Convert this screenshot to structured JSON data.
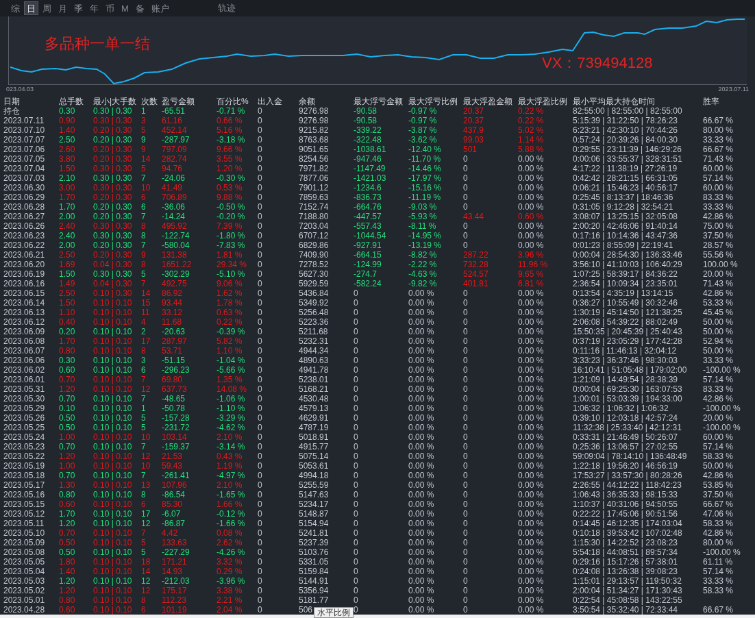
{
  "tabs": [
    {
      "label": "综",
      "selected": false
    },
    {
      "label": "日",
      "selected": true
    },
    {
      "label": "周",
      "selected": false
    },
    {
      "label": "月",
      "selected": false
    },
    {
      "label": "季",
      "selected": false
    },
    {
      "label": "年",
      "selected": false
    },
    {
      "label": "币",
      "selected": false
    },
    {
      "label": "M",
      "selected": false
    },
    {
      "label": "备",
      "selected": false
    },
    {
      "label": "账户",
      "selected": false
    }
  ],
  "track_label": "轨迹",
  "chart": {
    "annotations": [
      "多品种一单一结",
      "VX：739494128"
    ],
    "start_date": "023.04.03",
    "end_date": "2023.07.11"
  },
  "table": {
    "columns": [
      "日期",
      "总手数",
      "最小|大手数",
      "次数",
      "盈亏金额",
      "百分比%",
      "出入金",
      "余额",
      "最大浮亏金额",
      "最大浮亏比例",
      "最大浮盈金额",
      "最大浮盈比例",
      "最小平均最大持仓时间",
      "胜率"
    ],
    "rows": [
      {
        "cells": [
          "持仓",
          "0.30",
          "0.30 | 0.30",
          "1",
          "-65.51",
          "-0.71 %",
          "0",
          "9276.98",
          "-90.58",
          "-0.97 %",
          "20.37",
          "0.22 %",
          "82:55:00 | 82:55:00 | 82:55:00"
        ],
        "profit": false,
        "float_loss_marked": true,
        "float_profit_marked": true
      },
      {
        "cells": [
          "2023.07.11",
          "0.90",
          "0.30 | 0.30",
          "3",
          "61.16",
          "0.66 %",
          "0",
          "9276.98",
          "-90.58",
          "-0.97 %",
          "20.37",
          "0.22 %",
          "5:15:39 | 31:22:50 | 78:26:23",
          "66.67 %"
        ],
        "profit": true,
        "float_loss_marked": true,
        "float_profit_marked": true
      },
      {
        "cells": [
          "2023.07.10",
          "1.40",
          "0.20 | 0.30",
          "5",
          "452.14",
          "5.16 %",
          "0",
          "9215.82",
          "-339.22",
          "-3.87 %",
          "437.9",
          "5.02 %",
          "6:23:21 | 42:30:10 | 70:44:26",
          "80.00 %"
        ],
        "profit": true,
        "float_loss_marked": true,
        "float_profit_marked": true
      },
      {
        "cells": [
          "2023.07.07",
          "2.50",
          "0.20 | 0.30",
          "9",
          "-287.97",
          "-3.18 %",
          "0",
          "8763.68",
          "-322.48",
          "-3.62 %",
          "99.03",
          "1.14 %",
          "0:57:24 | 20:39:26 | 84:00:30",
          "33.33 %"
        ],
        "profit": false,
        "float_loss_marked": true,
        "float_profit_marked": true
      },
      {
        "cells": [
          "2023.07.06",
          "2.60",
          "0.20 | 0.30",
          "9",
          "797.09",
          "9.66 %",
          "0",
          "9051.65",
          "-1038.61",
          "-12.40 %",
          "501",
          "5.88 %",
          "0:29:55 | 23:11:39 | 146:29:26",
          "66.67 %"
        ],
        "profit": true,
        "float_loss_marked": true,
        "float_profit_marked": true
      },
      {
        "cells": [
          "2023.07.05",
          "3.80",
          "0.20 | 0.30",
          "14",
          "282.74",
          "3.55 %",
          "0",
          "8254.56",
          "-947.46",
          "-11.70 %",
          "0",
          "0.00 %",
          "0:00:06 | 33:55:37 | 328:31:51",
          "71.43 %"
        ],
        "profit": true,
        "float_loss_marked": true,
        "float_profit_marked": false
      },
      {
        "cells": [
          "2023.07.04",
          "1.50",
          "0.30 | 0.30",
          "5",
          "94.76",
          "1.20 %",
          "0",
          "7971.82",
          "-1147.49",
          "-14.46 %",
          "0",
          "0.00 %",
          "4:17:22 | 11:38:19 | 27:26:19",
          "60.00 %"
        ],
        "profit": true,
        "float_loss_marked": true,
        "float_profit_marked": false
      },
      {
        "cells": [
          "2023.07.03",
          "2.10",
          "0.30 | 0.30",
          "7",
          "-24.06",
          "-0.30 %",
          "0",
          "7877.06",
          "-1421.03",
          "-17.97 %",
          "0",
          "0.00 %",
          "0:42:42 | 28:21:15 | 66:31:05",
          "57.14 %"
        ],
        "profit": false,
        "float_loss_marked": true,
        "float_profit_marked": false
      },
      {
        "cells": [
          "2023.06.30",
          "3.00",
          "0.30 | 0.30",
          "10",
          "41.49",
          "0.53 %",
          "0",
          "7901.12",
          "-1234.6",
          "-15.16 %",
          "0",
          "0.00 %",
          "0:06:21 | 15:46:23 | 40:56:17",
          "60.00 %"
        ],
        "profit": true,
        "float_loss_marked": true,
        "float_profit_marked": false
      },
      {
        "cells": [
          "2023.06.29",
          "1.70",
          "0.20 | 0.30",
          "6",
          "706.89",
          "9.88 %",
          "0",
          "7859.63",
          "-836.73",
          "-11.19 %",
          "0",
          "0.00 %",
          "0:25:45 | 8:13:37 | 18:46:36",
          "83.33 %"
        ],
        "profit": true,
        "float_loss_marked": true,
        "float_profit_marked": false
      },
      {
        "cells": [
          "2023.06.28",
          "1.70",
          "0.20 | 0.30",
          "6",
          "-36.06",
          "-0.50 %",
          "0",
          "7152.74",
          "-664.76",
          "-9.03 %",
          "0",
          "0.00 %",
          "0:31:05 | 9:12:28 | 32:54:21",
          "33.33 %"
        ],
        "profit": false,
        "float_loss_marked": true,
        "float_profit_marked": false
      },
      {
        "cells": [
          "2023.06.27",
          "2.00",
          "0.20 | 0.30",
          "7",
          "-14.24",
          "-0.20 %",
          "0",
          "7188.80",
          "-447.57",
          "-5.93 %",
          "43.44",
          "0.60 %",
          "3:08:07 | 13:25:15 | 32:05:08",
          "42.86 %"
        ],
        "profit": false,
        "float_loss_marked": true,
        "float_profit_marked": true
      },
      {
        "cells": [
          "2023.06.26",
          "2.40",
          "0.30 | 0.30",
          "8",
          "495.92",
          "7.39 %",
          "0",
          "7203.04",
          "-557.43",
          "-8.11 %",
          "0",
          "0.00 %",
          "2:00:20 | 42:46:06 | 91:40:14",
          "75.00 %"
        ],
        "profit": true,
        "float_loss_marked": true,
        "float_profit_marked": false
      },
      {
        "cells": [
          "2023.06.23",
          "2.40",
          "0.30 | 0.30",
          "8",
          "-122.74",
          "-1.80 %",
          "0",
          "6707.12",
          "-1044.54",
          "-14.95 %",
          "0",
          "0.00 %",
          "0:17:16 | 10:14:36 | 43:47:36",
          "37.50 %"
        ],
        "profit": false,
        "float_loss_marked": true,
        "float_profit_marked": false
      },
      {
        "cells": [
          "2023.06.22",
          "2.00",
          "0.20 | 0.30",
          "7",
          "-580.04",
          "-7.83 %",
          "0",
          "6829.86",
          "-927.91",
          "-13.19 %",
          "0",
          "0.00 %",
          "0:01:23 | 8:55:09 | 22:19:41",
          "28.57 %"
        ],
        "profit": false,
        "float_loss_marked": true,
        "float_profit_marked": false
      },
      {
        "cells": [
          "2023.06.21",
          "2.50",
          "0.20 | 0.30",
          "9",
          "131.38",
          "1.81 %",
          "0",
          "7409.90",
          "-664.15",
          "-8.82 %",
          "287.22",
          "3.96 %",
          "0:00:04 | 28:54:30 | 136:33:46",
          "55.56 %"
        ],
        "profit": true,
        "float_loss_marked": true,
        "float_profit_marked": true
      },
      {
        "cells": [
          "2023.06.20",
          "1.69",
          "0.04 | 0.30",
          "8",
          "1651.22",
          "29.34 %",
          "0",
          "7278.52",
          "-124.99",
          "-2.22 %",
          "732.28",
          "11.96 %",
          "3:56:10 | 41:10:03 | 106:40:29",
          "100.00 %"
        ],
        "profit": true,
        "float_loss_marked": true,
        "float_profit_marked": true
      },
      {
        "cells": [
          "2023.06.19",
          "1.50",
          "0.30 | 0.30",
          "5",
          "-302.29",
          "-5.10 %",
          "0",
          "5627.30",
          "-274.7",
          "-4.63 %",
          "524.57",
          "9.65 %",
          "1:07:25 | 58:39:17 | 84:36:22",
          "20.00 %"
        ],
        "profit": false,
        "float_loss_marked": true,
        "float_profit_marked": true
      },
      {
        "cells": [
          "2023.06.16",
          "1.49",
          "0.04 | 0.30",
          "7",
          "492.75",
          "9.06 %",
          "0",
          "5929.59",
          "-582.24",
          "-9.82 %",
          "401.81",
          "6.81 %",
          "2:36:54 | 10:09:34 | 23:35:01",
          "71.43 %"
        ],
        "profit": true,
        "float_loss_marked": true,
        "float_profit_marked": true
      },
      {
        "cells": [
          "2023.06.15",
          "2.50",
          "0.10 | 0.30",
          "14",
          "86.92",
          "1.62 %",
          "0",
          "5436.84",
          "0",
          "0.00 %",
          "0",
          "0.00 %",
          "0:13:54 | 4:35:19 | 13:14:15",
          "42.86 %"
        ],
        "profit": true,
        "float_loss_marked": false,
        "float_profit_marked": false
      },
      {
        "cells": [
          "2023.06.14",
          "1.50",
          "0.10 | 0.10",
          "15",
          "93.44",
          "1.78 %",
          "0",
          "5349.92",
          "0",
          "0.00 %",
          "0",
          "0.00 %",
          "0:36:27 | 10:55:49 | 30:32:46",
          "53.33 %"
        ],
        "profit": true,
        "float_loss_marked": false,
        "float_profit_marked": false
      },
      {
        "cells": [
          "2023.06.13",
          "1.10",
          "0.10 | 0.10",
          "11",
          "33.12",
          "0.63 %",
          "0",
          "5256.48",
          "0",
          "0.00 %",
          "0",
          "0.00 %",
          "1:30:19 | 45:14:50 | 121:38:25",
          "45.45 %"
        ],
        "profit": true,
        "float_loss_marked": false,
        "float_profit_marked": false
      },
      {
        "cells": [
          "2023.06.12",
          "0.40",
          "0.10 | 0.10",
          "4",
          "11.68",
          "0.22 %",
          "0",
          "5223.36",
          "0",
          "0.00 %",
          "0",
          "0.00 %",
          "2:06:08 | 54:39:22 | 88:02:49",
          "50.00 %"
        ],
        "profit": true,
        "float_loss_marked": false,
        "float_profit_marked": false
      },
      {
        "cells": [
          "2023.06.09",
          "0.20",
          "0.10 | 0.10",
          "2",
          "-20.63",
          "-0.39 %",
          "0",
          "5211.68",
          "0",
          "0.00 %",
          "0",
          "0.00 %",
          "15:50:35 | 20:45:39 | 25:40:43",
          "50.00 %"
        ],
        "profit": false,
        "float_loss_marked": false,
        "float_profit_marked": false
      },
      {
        "cells": [
          "2023.06.08",
          "1.70",
          "0.10 | 0.10",
          "17",
          "287.97",
          "5.82 %",
          "0",
          "5232.31",
          "0",
          "0.00 %",
          "0",
          "0.00 %",
          "0:37:19 | 23:05:29 | 177:42:28",
          "52.94 %"
        ],
        "profit": true,
        "float_loss_marked": false,
        "float_profit_marked": false
      },
      {
        "cells": [
          "2023.06.07",
          "0.80",
          "0.10 | 0.10",
          "8",
          "53.71",
          "1.10 %",
          "0",
          "4944.34",
          "0",
          "0.00 %",
          "0",
          "0.00 %",
          "0:11:16 | 11:46:13 | 32:04:12",
          "50.00 %"
        ],
        "profit": true,
        "float_loss_marked": false,
        "float_profit_marked": false
      },
      {
        "cells": [
          "2023.06.06",
          "0.30",
          "0.10 | 0.10",
          "3",
          "-51.15",
          "-1.04 %",
          "0",
          "4890.63",
          "0",
          "0.00 %",
          "0",
          "0.00 %",
          "3:33:23 | 36:37:46 | 98:30:03",
          "33.33 %"
        ],
        "profit": false,
        "float_loss_marked": false,
        "float_profit_marked": false
      },
      {
        "cells": [
          "2023.06.02",
          "0.60",
          "0.10 | 0.10",
          "6",
          "-296.23",
          "-5.66 %",
          "0",
          "4941.78",
          "0",
          "0.00 %",
          "0",
          "0.00 %",
          "16:10:41 | 51:05:48 | 179:02:00",
          "-100.00 %"
        ],
        "profit": false,
        "float_loss_marked": false,
        "float_profit_marked": false
      },
      {
        "cells": [
          "2023.06.01",
          "0.70",
          "0.10 | 0.10",
          "7",
          "69.80",
          "1.35 %",
          "0",
          "5238.01",
          "0",
          "0.00 %",
          "0",
          "0.00 %",
          "1:21:09 | 14:49:54 | 28:38:39",
          "57.14 %"
        ],
        "profit": true,
        "float_loss_marked": false,
        "float_profit_marked": false
      },
      {
        "cells": [
          "2023.05.31",
          "1.20",
          "0.10 | 0.10",
          "12",
          "637.73",
          "14.08 %",
          "0",
          "5168.21",
          "0",
          "0.00 %",
          "0",
          "0.00 %",
          "0:00:04 | 69:25:30 | 163:07:53",
          "83.33 %"
        ],
        "profit": true,
        "float_loss_marked": false,
        "float_profit_marked": false
      },
      {
        "cells": [
          "2023.05.30",
          "0.70",
          "0.10 | 0.10",
          "7",
          "-48.65",
          "-1.06 %",
          "0",
          "4530.48",
          "0",
          "0.00 %",
          "0",
          "0.00 %",
          "1:00:01 | 53:03:39 | 194:33:00",
          "42.86 %"
        ],
        "profit": false,
        "float_loss_marked": false,
        "float_profit_marked": false
      },
      {
        "cells": [
          "2023.05.29",
          "0.10",
          "0.10 | 0.10",
          "1",
          "-50.78",
          "-1.10 %",
          "0",
          "4579.13",
          "0",
          "0.00 %",
          "0",
          "0.00 %",
          "1:06:32 | 1:06:32 | 1:06:32",
          "-100.00 %"
        ],
        "profit": false,
        "float_loss_marked": false,
        "float_profit_marked": false
      },
      {
        "cells": [
          "2023.05.26",
          "0.50",
          "0.10 | 0.10",
          "5",
          "-157.28",
          "-3.29 %",
          "0",
          "4629.91",
          "0",
          "0.00 %",
          "0",
          "0.00 %",
          "0:39:10 | 12:03:18 | 42:57:24",
          "20.00 %"
        ],
        "profit": false,
        "float_loss_marked": false,
        "float_profit_marked": false
      },
      {
        "cells": [
          "2023.05.25",
          "0.50",
          "0.10 | 0.10",
          "5",
          "-231.72",
          "-4.62 %",
          "0",
          "4787.19",
          "0",
          "0.00 %",
          "0",
          "0.00 %",
          "11:32:38 | 25:33:40 | 42:12:31",
          "-100.00 %"
        ],
        "profit": false,
        "float_loss_marked": false,
        "float_profit_marked": false
      },
      {
        "cells": [
          "2023.05.24",
          "1.00",
          "0.10 | 0.10",
          "10",
          "103.14",
          "2.10 %",
          "0",
          "5018.91",
          "0",
          "0.00 %",
          "0",
          "0.00 %",
          "0:33:31 | 21:46:49 | 50:26:07",
          "60.00 %"
        ],
        "profit": true,
        "float_loss_marked": false,
        "float_profit_marked": false
      },
      {
        "cells": [
          "2023.05.23",
          "0.70",
          "0.10 | 0.10",
          "7",
          "-159.37",
          "-3.14 %",
          "0",
          "4915.77",
          "0",
          "0.00 %",
          "0",
          "0.00 %",
          "0:25:36 | 13:06:57 | 27:02:55",
          "57.14 %"
        ],
        "profit": false,
        "float_loss_marked": false,
        "float_profit_marked": false
      },
      {
        "cells": [
          "2023.05.22",
          "1.20",
          "0.10 | 0.10",
          "12",
          "21.53",
          "0.43 %",
          "0",
          "5075.14",
          "0",
          "0.00 %",
          "0",
          "0.00 %",
          "59:09:04 | 78:14:10 | 136:48:49",
          "58.33 %"
        ],
        "profit": true,
        "float_loss_marked": false,
        "float_profit_marked": false
      },
      {
        "cells": [
          "2023.05.19",
          "1.00",
          "0.10 | 0.10",
          "10",
          "59.43",
          "1.19 %",
          "0",
          "5053.61",
          "0",
          "0.00 %",
          "0",
          "0.00 %",
          "1:22:18 | 19:56:20 | 46:56:19",
          "50.00 %"
        ],
        "profit": true,
        "float_loss_marked": false,
        "float_profit_marked": false
      },
      {
        "cells": [
          "2023.05.18",
          "0.70",
          "0.10 | 0.10",
          "7",
          "-261.41",
          "-4.97 %",
          "0",
          "4994.18",
          "0",
          "0.00 %",
          "0",
          "0.00 %",
          "17:53:27 | 33:57:30 | 80:28:26",
          "42.86 %"
        ],
        "profit": false,
        "float_loss_marked": false,
        "float_profit_marked": false
      },
      {
        "cells": [
          "2023.05.17",
          "1.30",
          "0.10 | 0.10",
          "13",
          "107.96",
          "2.10 %",
          "0",
          "5255.59",
          "0",
          "0.00 %",
          "0",
          "0.00 %",
          "2:26:55 | 44:12:22 | 118:42:23",
          "53.85 %"
        ],
        "profit": true,
        "float_loss_marked": false,
        "float_profit_marked": false
      },
      {
        "cells": [
          "2023.05.16",
          "0.80",
          "0.10 | 0.10",
          "8",
          "-86.54",
          "-1.65 %",
          "0",
          "5147.63",
          "0",
          "0.00 %",
          "0",
          "0.00 %",
          "1:06:43 | 36:35:33 | 98:15:33",
          "37.50 %"
        ],
        "profit": false,
        "float_loss_marked": false,
        "float_profit_marked": false
      },
      {
        "cells": [
          "2023.05.15",
          "0.60",
          "0.10 | 0.10",
          "6",
          "85.30",
          "1.66 %",
          "0",
          "5234.17",
          "0",
          "0.00 %",
          "0",
          "0.00 %",
          "1:10:37 | 40:31:06 | 94:50:55",
          "66.67 %"
        ],
        "profit": true,
        "float_loss_marked": false,
        "float_profit_marked": false
      },
      {
        "cells": [
          "2023.05.12",
          "1.70",
          "0.10 | 0.10",
          "17",
          "-6.07",
          "-0.12 %",
          "0",
          "5148.87",
          "0",
          "0.00 %",
          "0",
          "0.00 %",
          "0:22:22 | 17:45:06 | 90:51:56",
          "47.06 %"
        ],
        "profit": false,
        "float_loss_marked": false,
        "float_profit_marked": false
      },
      {
        "cells": [
          "2023.05.11",
          "1.20",
          "0.10 | 0.10",
          "12",
          "-86.87",
          "-1.66 %",
          "0",
          "5154.94",
          "0",
          "0.00 %",
          "0",
          "0.00 %",
          "0:14:45 | 46:12:35 | 174:03:04",
          "58.33 %"
        ],
        "profit": false,
        "float_loss_marked": false,
        "float_profit_marked": false
      },
      {
        "cells": [
          "2023.05.10",
          "0.70",
          "0.10 | 0.10",
          "7",
          "4.42",
          "0.08 %",
          "0",
          "5241.81",
          "0",
          "0.00 %",
          "0",
          "0.00 %",
          "0:10:18 | 39:53:42 | 107:02:48",
          "42.86 %"
        ],
        "profit": true,
        "float_loss_marked": false,
        "float_profit_marked": false
      },
      {
        "cells": [
          "2023.05.09",
          "0.50",
          "0.10 | 0.10",
          "5",
          "133.63",
          "2.62 %",
          "0",
          "5237.39",
          "0",
          "0.00 %",
          "0",
          "0.00 %",
          "1:15:30 | 14:22:52 | 23:08:23",
          "80.00 %"
        ],
        "profit": true,
        "float_loss_marked": false,
        "float_profit_marked": false
      },
      {
        "cells": [
          "2023.05.08",
          "0.50",
          "0.10 | 0.10",
          "5",
          "-227.29",
          "-4.26 %",
          "0",
          "5103.76",
          "0",
          "0.00 %",
          "0",
          "0.00 %",
          "5:54:18 | 44:08:51 | 89:57:34",
          "-100.00 %"
        ],
        "profit": false,
        "float_loss_marked": false,
        "float_profit_marked": false
      },
      {
        "cells": [
          "2023.05.05",
          "1.80",
          "0.10 | 0.10",
          "18",
          "171.21",
          "3.32 %",
          "0",
          "5331.05",
          "0",
          "0.00 %",
          "0",
          "0.00 %",
          "0:29:16 | 15:17:26 | 57:38:01",
          "61.11 %"
        ],
        "profit": true,
        "float_loss_marked": false,
        "float_profit_marked": false
      },
      {
        "cells": [
          "2023.05.04",
          "1.40",
          "0.10 | 0.10",
          "14",
          "14.93",
          "0.29 %",
          "0",
          "5159.84",
          "0",
          "0.00 %",
          "0",
          "0.00 %",
          "0:24:08 | 13:26:38 | 39:08:23",
          "57.14 %"
        ],
        "profit": true,
        "float_loss_marked": false,
        "float_profit_marked": false
      },
      {
        "cells": [
          "2023.05.03",
          "1.20",
          "0.10 | 0.10",
          "12",
          "-212.03",
          "-3.96 %",
          "0",
          "5144.91",
          "0",
          "0.00 %",
          "0",
          "0.00 %",
          "1:15:01 | 29:13:57 | 119:50:32",
          "33.33 %"
        ],
        "profit": false,
        "float_loss_marked": false,
        "float_profit_marked": false
      },
      {
        "cells": [
          "2023.05.02",
          "1.20",
          "0.10 | 0.10",
          "12",
          "175.17",
          "3.38 %",
          "0",
          "5356.94",
          "0",
          "0.00 %",
          "0",
          "0.00 %",
          "2:00:04 | 51:34:27 | 171:30:43",
          "58.33 %"
        ],
        "profit": true,
        "float_loss_marked": false,
        "float_profit_marked": false
      },
      {
        "cells": [
          "2023.05.01",
          "0.80",
          "0.10 | 0.10",
          "8",
          "112.23",
          "2.21 %",
          "0",
          "5181.77",
          "0",
          "0.00 %",
          "0",
          "0.00 %",
          "0:22:54 | 45:08:58 | 143:22:55"
        ],
        "profit": true,
        "float_loss_marked": false,
        "float_profit_marked": false
      },
      {
        "cells": [
          "2023.04.28",
          "0.60",
          "0.10 | 0.10",
          "6",
          "101.19",
          "2.04 %",
          "0",
          "506",
          "0",
          "0.00 %",
          "0",
          "0.00 %",
          "3:50:54 | 35:32:40 | 72:33:44",
          "66.67 %"
        ],
        "profit": true,
        "float_loss_marked": false,
        "float_profit_marked": false
      }
    ]
  },
  "tooltip": "水平比例"
}
